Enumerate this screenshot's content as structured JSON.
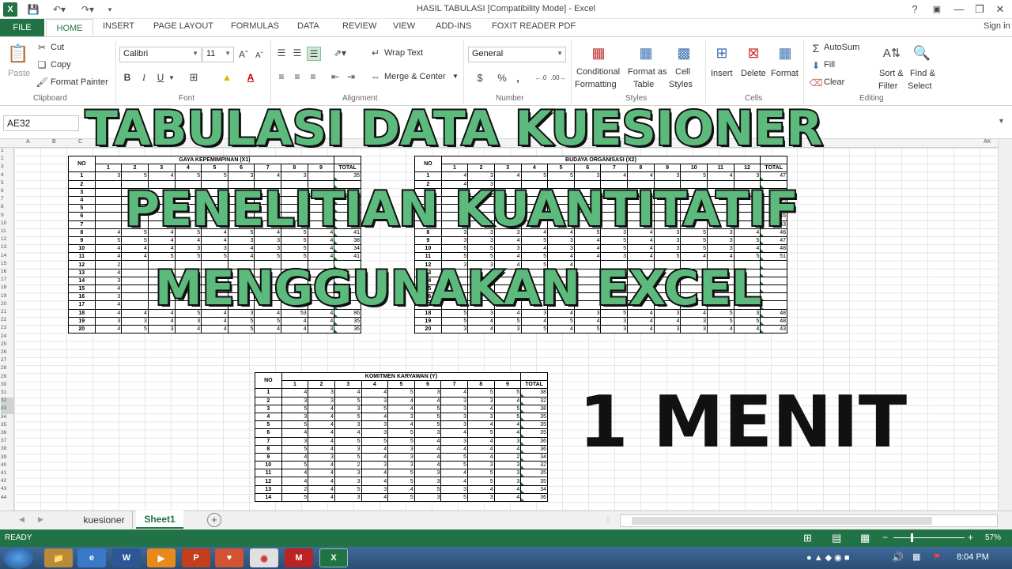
{
  "window": {
    "title": "HASIL TABULASI  [Compatibility Mode] - Excel",
    "help": "?",
    "minimize": "—",
    "restore": "❐",
    "close": "✕",
    "sign_in": "Sign in"
  },
  "tabs": [
    "FILE",
    "HOME",
    "INSERT",
    "PAGE LAYOUT",
    "FORMULAS",
    "DATA",
    "REVIEW",
    "VIEW",
    "ADD-INS",
    "FOXIT READER PDF"
  ],
  "ribbon": {
    "clipboard": {
      "paste": "Paste",
      "cut": "Cut",
      "copy": "Copy",
      "painter": "Format Painter",
      "label": "Clipboard"
    },
    "font": {
      "name": "Calibri",
      "size": "11",
      "bold": "B",
      "italic": "I",
      "underline": "U",
      "label": "Font"
    },
    "alignment": {
      "wrap": "Wrap Text",
      "merge": "Merge & Center",
      "label": "Alignment"
    },
    "number": {
      "format": "General",
      "currency": "$",
      "percent": "%",
      "comma": ",",
      "label": "Number"
    },
    "styles": {
      "conditional": "Conditional",
      "conditional2": "Formatting",
      "format_table": "Format as",
      "format_table2": "Table",
      "cell_styles": "Cell",
      "cell_styles2": "Styles",
      "label": "Styles"
    },
    "cells": {
      "insert": "Insert",
      "delete": "Delete",
      "format": "Format",
      "label": "Cells"
    },
    "editing": {
      "autosum": "AutoSum",
      "fill": "Fill",
      "clear": "Clear",
      "sort": "Sort &",
      "sort2": "Filter",
      "find": "Find &",
      "find2": "Select",
      "label": "Editing"
    }
  },
  "name_box": "AE32",
  "colors": {
    "excel_green": "#217346",
    "overlay_green": "#5dba7d"
  },
  "columns": [
    "A",
    "B",
    "C",
    "O",
    "AK"
  ],
  "rows": [
    "1",
    "2",
    "3",
    "4",
    "5",
    "6",
    "7",
    "8",
    "9",
    "10",
    "11",
    "12",
    "13",
    "14",
    "15",
    "16",
    "17",
    "18",
    "19",
    "20",
    "21",
    "22",
    "23",
    "24",
    "25",
    "26",
    "27",
    "28",
    "29",
    "30",
    "31",
    "32",
    "33",
    "34",
    "35",
    "36",
    "37",
    "38",
    "39",
    "40",
    "41",
    "42",
    "43",
    "44"
  ],
  "table_x1": {
    "title": "GAYA KEPEMIMPINAN (X1)",
    "no_label": "NO",
    "total_label": "TOTAL",
    "items": [
      "1",
      "2",
      "3",
      "4",
      "5",
      "6",
      "7",
      "8",
      "9"
    ],
    "rows": [
      {
        "no": "1",
        "v": [
          "3",
          "5",
          "4",
          "5",
          "5",
          "3",
          "4",
          "3",
          ""
        ],
        "total": "35"
      },
      {
        "no": "2",
        "v": [
          "",
          "",
          "",
          "",
          "",
          "",
          "",
          "",
          ""
        ],
        "total": ""
      },
      {
        "no": "3",
        "v": [
          "",
          "",
          "",
          "",
          "",
          "",
          "",
          "",
          ""
        ],
        "total": ""
      },
      {
        "no": "4",
        "v": [
          "",
          "",
          "",
          "",
          "",
          "",
          "",
          "",
          ""
        ],
        "total": ""
      },
      {
        "no": "5",
        "v": [
          "",
          "",
          "",
          "",
          "",
          "",
          "",
          "",
          ""
        ],
        "total": ""
      },
      {
        "no": "6",
        "v": [
          "",
          "",
          "",
          "",
          "",
          "",
          "",
          "",
          ""
        ],
        "total": ""
      },
      {
        "no": "7",
        "v": [
          "",
          "",
          "",
          "",
          "",
          "",
          "",
          "",
          ""
        ],
        "total": ""
      },
      {
        "no": "8",
        "v": [
          "4",
          "5",
          "4",
          "5",
          "4",
          "5",
          "4",
          "5",
          "4"
        ],
        "total": "41"
      },
      {
        "no": "9",
        "v": [
          "5",
          "5",
          "4",
          "4",
          "4",
          "3",
          "3",
          "5",
          "4"
        ],
        "total": "38"
      },
      {
        "no": "10",
        "v": [
          "4",
          "4",
          "4",
          "3",
          "3",
          "4",
          "3",
          "5",
          "4"
        ],
        "total": "34"
      },
      {
        "no": "11",
        "v": [
          "4",
          "4",
          "5",
          "5",
          "5",
          "4",
          "5",
          "5",
          "4"
        ],
        "total": "41"
      },
      {
        "no": "12",
        "v": [
          "2",
          "",
          "",
          "",
          "",
          "",
          "",
          "",
          ""
        ],
        "total": ""
      },
      {
        "no": "13",
        "v": [
          "4",
          "",
          "",
          "",
          "",
          "",
          "",
          "",
          ""
        ],
        "total": ""
      },
      {
        "no": "14",
        "v": [
          "3",
          "",
          "",
          "",
          "",
          "",
          "",
          "",
          ""
        ],
        "total": ""
      },
      {
        "no": "15",
        "v": [
          "4",
          "",
          "",
          "",
          "",
          "",
          "",
          "",
          ""
        ],
        "total": ""
      },
      {
        "no": "16",
        "v": [
          "3",
          "",
          "",
          "",
          "",
          "",
          "",
          "",
          ""
        ],
        "total": ""
      },
      {
        "no": "17",
        "v": [
          "4",
          "",
          "",
          "",
          "",
          "",
          "",
          "",
          ""
        ],
        "total": ""
      },
      {
        "no": "18",
        "v": [
          "4",
          "4",
          "4",
          "5",
          "4",
          "3",
          "4",
          "53",
          "4"
        ],
        "total": "86"
      },
      {
        "no": "19",
        "v": [
          "3",
          "3",
          "4",
          "3",
          "4",
          "5",
          "5",
          "4",
          "4"
        ],
        "total": "35"
      },
      {
        "no": "20",
        "v": [
          "4",
          "5",
          "3",
          "4",
          "4",
          "5",
          "4",
          "4",
          "3"
        ],
        "total": "36"
      }
    ]
  },
  "table_x2": {
    "title": "BUDAYA ORGANISASI (X2)",
    "no_label": "NO",
    "total_label": "TOTAL",
    "items": [
      "1",
      "2",
      "3",
      "4",
      "5",
      "6",
      "7",
      "8",
      "9",
      "10",
      "11",
      "12"
    ],
    "rows": [
      {
        "no": "1",
        "v": [
          "4",
          "3",
          "4",
          "5",
          "5",
          "3",
          "4",
          "4",
          "3",
          "5",
          "4",
          "3"
        ],
        "total": "47"
      },
      {
        "no": "2",
        "v": [
          "4",
          "3",
          "",
          "",
          "",
          "",
          "",
          "",
          "",
          "",
          "",
          ""
        ],
        "total": ""
      },
      {
        "no": "3",
        "v": [
          "",
          "",
          "",
          "",
          "",
          "",
          "",
          "",
          "",
          "",
          "",
          ""
        ],
        "total": ""
      },
      {
        "no": "4",
        "v": [
          "",
          "",
          "",
          "",
          "",
          "",
          "",
          "",
          "",
          "",
          "",
          ""
        ],
        "total": "43"
      },
      {
        "no": "5",
        "v": [
          "",
          "",
          "",
          "",
          "",
          "",
          "",
          "",
          "",
          "",
          "",
          ""
        ],
        "total": "43"
      },
      {
        "no": "6",
        "v": [
          "",
          "",
          "",
          "",
          "",
          "",
          "",
          "",
          "",
          "",
          "",
          ""
        ],
        "total": "45"
      },
      {
        "no": "7",
        "v": [
          "",
          "",
          "",
          "",
          "",
          "",
          "",
          "",
          "",
          "",
          "",
          ""
        ],
        "total": "43"
      },
      {
        "no": "8",
        "v": [
          "3",
          "3",
          "3",
          "4",
          "4",
          "5",
          "3",
          "4",
          "3",
          "5",
          "3",
          "4"
        ],
        "total": "46"
      },
      {
        "no": "9",
        "v": [
          "3",
          "3",
          "4",
          "5",
          "3",
          "4",
          "5",
          "4",
          "3",
          "5",
          "3",
          "5"
        ],
        "total": "47"
      },
      {
        "no": "10",
        "v": [
          "5",
          "5",
          "3",
          "4",
          "3",
          "4",
          "5",
          "4",
          "3",
          "5",
          "3",
          "4"
        ],
        "total": "48"
      },
      {
        "no": "11",
        "v": [
          "5",
          "5",
          "4",
          "5",
          "4",
          "4",
          "3",
          "4",
          "5",
          "4",
          "4",
          "5"
        ],
        "total": "51"
      },
      {
        "no": "12",
        "v": [
          "3",
          "3",
          "4",
          "5",
          "4",
          "",
          "",
          "",
          "",
          "",
          "",
          ""
        ],
        "total": ""
      },
      {
        "no": "13",
        "v": [
          "",
          "",
          "",
          "",
          "",
          "",
          "",
          "",
          "",
          "",
          "",
          ""
        ],
        "total": ""
      },
      {
        "no": "14",
        "v": [
          "",
          "",
          "",
          "",
          "",
          "",
          "",
          "",
          "",
          "",
          "",
          ""
        ],
        "total": ""
      },
      {
        "no": "15",
        "v": [
          "",
          "",
          "",
          "",
          "",
          "",
          "",
          "",
          "",
          "",
          "",
          ""
        ],
        "total": ""
      },
      {
        "no": "16",
        "v": [
          "",
          "",
          "",
          "",
          "",
          "",
          "",
          "",
          "",
          "",
          "",
          ""
        ],
        "total": ""
      },
      {
        "no": "17",
        "v": [
          "",
          "",
          "",
          "",
          "",
          "",
          "",
          "",
          "",
          "",
          "",
          ""
        ],
        "total": ""
      },
      {
        "no": "18",
        "v": [
          "5",
          "3",
          "4",
          "3",
          "4",
          "3",
          "5",
          "4",
          "3",
          "4",
          "5",
          "3"
        ],
        "total": "48"
      },
      {
        "no": "19",
        "v": [
          "5",
          "4",
          "5",
          "4",
          "5",
          "4",
          "3",
          "4",
          "4",
          "3",
          "5",
          "5"
        ],
        "total": "48"
      },
      {
        "no": "20",
        "v": [
          "3",
          "4",
          "3",
          "5",
          "4",
          "5",
          "3",
          "4",
          "3",
          "3",
          "4",
          "4"
        ],
        "total": "43"
      }
    ]
  },
  "table_y": {
    "title": "KOMITMEN KARYAWAN (Y)",
    "no_label": "NO",
    "total_label": "TOTAL",
    "items": [
      "1",
      "2",
      "3",
      "4",
      "5",
      "6",
      "7",
      "8",
      "9"
    ],
    "rows": [
      {
        "no": "1",
        "v": [
          "4",
          "3",
          "4",
          "4",
          "5",
          "3",
          "4",
          "5",
          "5"
        ],
        "total": "38"
      },
      {
        "no": "2",
        "v": [
          "3",
          "3",
          "5",
          "3",
          "4",
          "4",
          "3",
          "3",
          "4"
        ],
        "total": "32"
      },
      {
        "no": "3",
        "v": [
          "5",
          "4",
          "3",
          "5",
          "4",
          "5",
          "3",
          "4",
          "5"
        ],
        "total": "38"
      },
      {
        "no": "4",
        "v": [
          "3",
          "4",
          "5",
          "4",
          "3",
          "5",
          "3",
          "3",
          "5"
        ],
        "total": "35"
      },
      {
        "no": "5",
        "v": [
          "5",
          "4",
          "3",
          "3",
          "4",
          "5",
          "3",
          "4",
          "4"
        ],
        "total": "35"
      },
      {
        "no": "6",
        "v": [
          "4",
          "4",
          "4",
          "3",
          "5",
          "3",
          "4",
          "5",
          "4"
        ],
        "total": "35"
      },
      {
        "no": "7",
        "v": [
          "3",
          "4",
          "5",
          "5",
          "5",
          "4",
          "3",
          "4",
          "3"
        ],
        "total": "36"
      },
      {
        "no": "8",
        "v": [
          "5",
          "4",
          "3",
          "4",
          "3",
          "4",
          "4",
          "4",
          "4"
        ],
        "total": "36"
      },
      {
        "no": "9",
        "v": [
          "4",
          "3",
          "5",
          "4",
          "3",
          "4",
          "5",
          "4",
          "2"
        ],
        "total": "34"
      },
      {
        "no": "10",
        "v": [
          "5",
          "4",
          "2",
          "3",
          "3",
          "4",
          "5",
          "3",
          "3"
        ],
        "total": "32"
      },
      {
        "no": "11",
        "v": [
          "4",
          "4",
          "3",
          "4",
          "5",
          "3",
          "4",
          "5",
          "3"
        ],
        "total": "35"
      },
      {
        "no": "12",
        "v": [
          "4",
          "4",
          "3",
          "4",
          "5",
          "3",
          "4",
          "5",
          "3"
        ],
        "total": "35"
      },
      {
        "no": "13",
        "v": [
          "2",
          "4",
          "5",
          "3",
          "4",
          "5",
          "3",
          "4",
          "4"
        ],
        "total": "34"
      },
      {
        "no": "14",
        "v": [
          "5",
          "4",
          "3",
          "4",
          "5",
          "3",
          "5",
          "3",
          "4"
        ],
        "total": "36"
      }
    ]
  },
  "overlay": {
    "line1": "TABULASI DATA KUESIONER",
    "line2": "PENELITIAN KUANTITATIF",
    "line3": "MENGGUNAKAN EXCEL",
    "line4": "1 MENIT"
  },
  "sheet_tabs": [
    "kuesioner",
    "Sheet1"
  ],
  "active_sheet": "Sheet1",
  "status": {
    "ready": "READY",
    "zoom": "57%",
    "zoom_minus": "−",
    "zoom_plus": "+"
  },
  "taskbar": {
    "time": "8:04 PM"
  }
}
